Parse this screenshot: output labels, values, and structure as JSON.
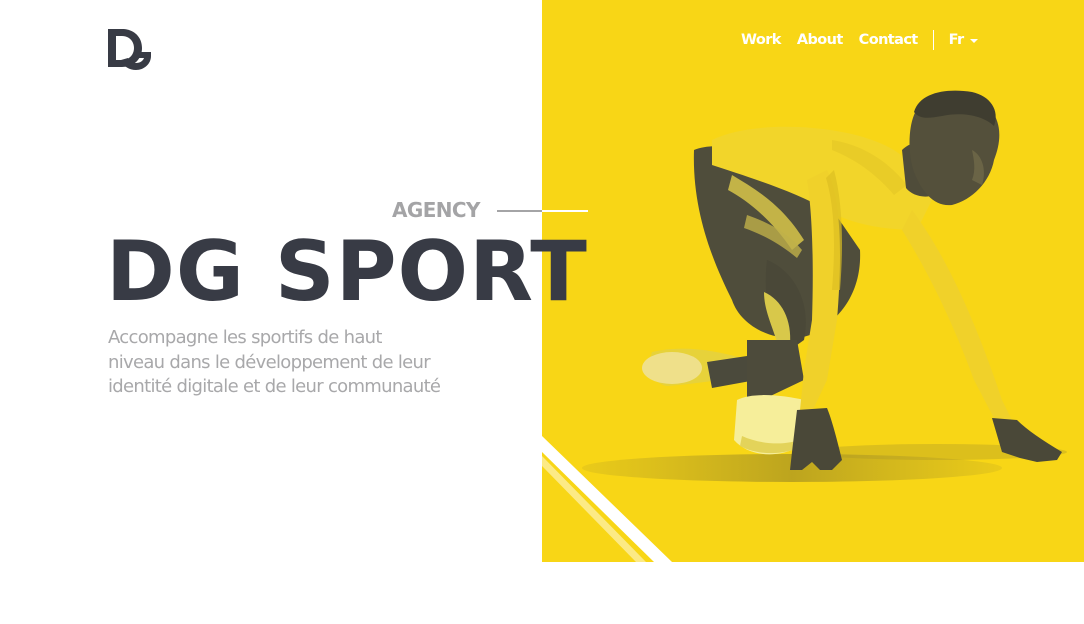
{
  "nav": {
    "items": [
      {
        "label": "Work"
      },
      {
        "label": "About"
      },
      {
        "label": "Contact"
      }
    ],
    "language": "Fr"
  },
  "hero": {
    "eyebrow": "AGENCY",
    "title": "DG SPORT",
    "subtitle": "Accompagne les sportifs de haut\nniveau dans le développement de leur\nidentité digitale et de leur communauté"
  },
  "colors": {
    "accent_yellow": "#f8d616",
    "title_dark": "#383b45",
    "muted_grey": "#a8a8aa"
  },
  "icons": {
    "logo": "dg-logo-icon",
    "language_caret": "chevron-down-icon"
  }
}
